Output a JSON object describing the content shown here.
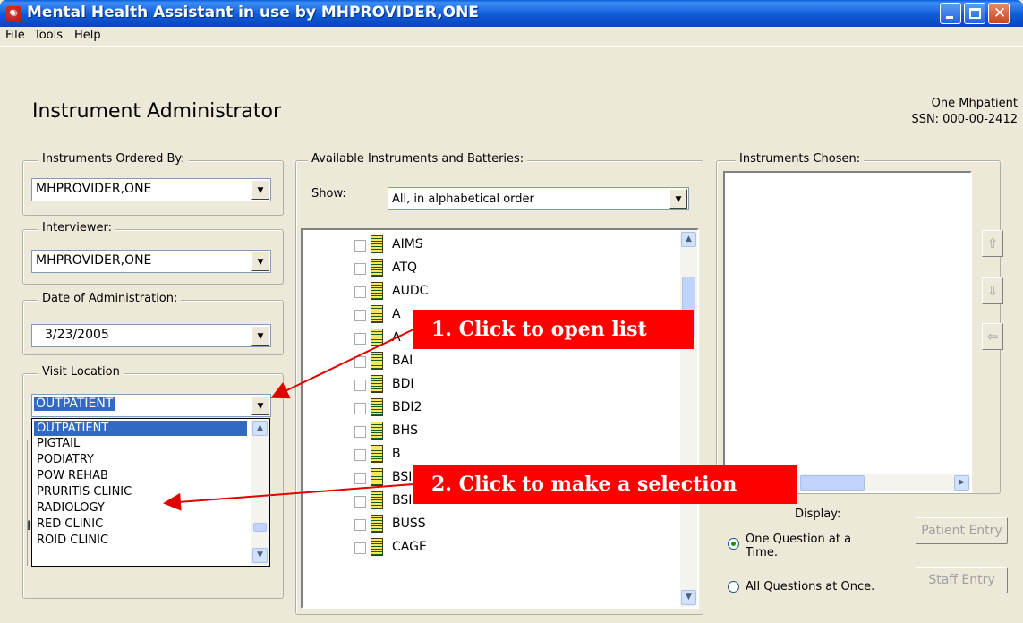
{
  "window": {
    "title": "Mental Health Assistant in use by MHPROVIDER,ONE",
    "app_icon_glyph": "◉"
  },
  "menu": [
    "File",
    "Tools",
    "Help"
  ],
  "header": {
    "title": "Instrument Administrator",
    "patient_name": "One Mhpatient",
    "patient_ssn": "SSN: 000-00-2412"
  },
  "left": {
    "ordered_by": {
      "label": "Instruments Ordered By:",
      "value": "MHPROVIDER,ONE"
    },
    "interviewer": {
      "label": "Interviewer:",
      "value": "MHPROVIDER,ONE"
    },
    "date": {
      "label": "Date of Administration:",
      "value": "3/23/2005"
    },
    "visit_location": {
      "label": "Visit Location",
      "value": "OUTPATIENT",
      "list_items": [
        "OUTPATIENT",
        "PIGTAIL",
        "PODIATRY",
        "POW REHAB",
        "PRURITIS CLINIC",
        "RADIOLOGY",
        "RED CLINIC",
        "ROID CLINIC"
      ],
      "highlighted_index": 0,
      "background_fragment": "H"
    }
  },
  "middle": {
    "label": "Available Instruments and Batteries:",
    "show_label": "Show:",
    "show_value": "All, in alphabetical order",
    "instruments": [
      "AIMS",
      "ATQ",
      "AUDC",
      "A",
      "A",
      "BAI",
      "BDI",
      "BDI2",
      "BHS",
      "B",
      "BSI",
      "BSI18",
      "BUSS",
      "CAGE"
    ]
  },
  "right": {
    "label": "Instruments Chosen:",
    "display_label": "Display:",
    "options": [
      "One Question at a Time.",
      "All Questions at Once."
    ],
    "selected_option": 0,
    "patient_entry": "Patient Entry",
    "staff_entry": "Staff Entry"
  },
  "callouts": [
    "1. Click to open list",
    "2. Click to make a selection"
  ],
  "colors": {
    "titlebar": "#0a5fd8",
    "selection": "#316ac5",
    "callout": "#ff0000",
    "arrow": "#e00000"
  }
}
